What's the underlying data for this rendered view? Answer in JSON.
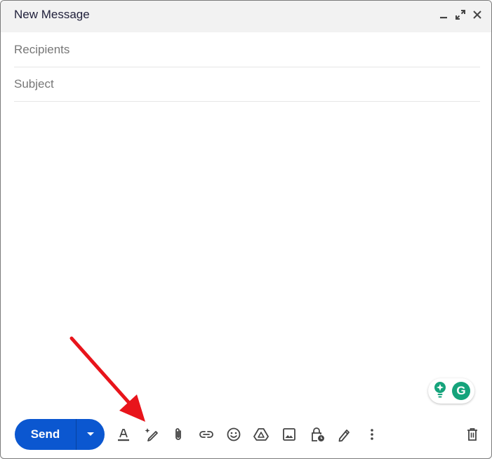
{
  "window": {
    "title": "New Message",
    "controls": [
      "minimize-icon",
      "expand-icon",
      "close-icon"
    ]
  },
  "fields": {
    "recipients_placeholder": "Recipients",
    "recipients_value": "",
    "subject_placeholder": "Subject",
    "subject_value": ""
  },
  "body": {
    "value": ""
  },
  "toolbar": {
    "send_label": "Send",
    "icons": [
      "formatting-options-icon",
      "help-me-write-icon",
      "attach-file-icon",
      "insert-link-icon",
      "insert-emoji-icon",
      "insert-drive-icon",
      "insert-photo-icon",
      "confidential-mode-icon",
      "insert-signature-icon",
      "more-options-icon",
      "discard-draft-icon"
    ]
  },
  "colors": {
    "send_button": "#0b57d0",
    "header_bg": "#f2f2f2",
    "grammarly": "#15a37b",
    "annotation_arrow": "#e8141b"
  }
}
